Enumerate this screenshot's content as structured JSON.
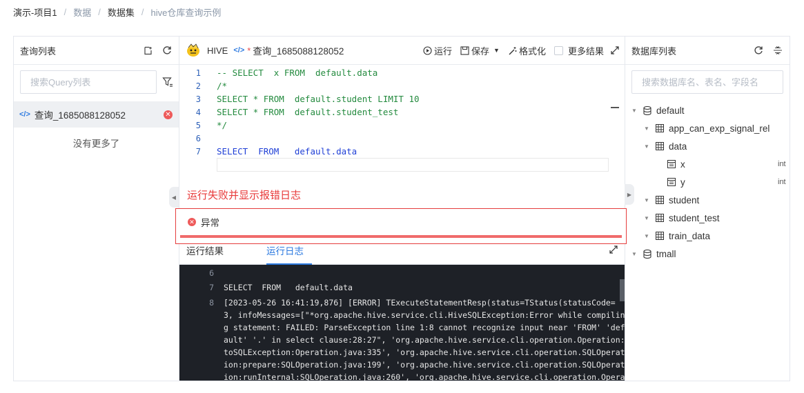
{
  "breadcrumb": {
    "items": [
      "演示-项目1",
      "数据",
      "数据集",
      "hive仓库查询示例"
    ],
    "separator": "/"
  },
  "left_panel": {
    "title": "查询列表",
    "search_placeholder": "搜索Query列表",
    "query_item": "查询_1685088128052",
    "no_more": "没有更多了"
  },
  "editor": {
    "engine_label": "HIVE",
    "code_icon": "</>",
    "unsaved_mark": "*",
    "tab_name": "查询_1685088128052",
    "toolbar": {
      "run": "运行",
      "save": "保存",
      "format": "格式化",
      "more_results": "更多结果"
    },
    "lines": [
      {
        "n": "1",
        "text": "-- SELECT  x FROM  default.data"
      },
      {
        "n": "2",
        "text": "/*"
      },
      {
        "n": "3",
        "text": "SELECT * FROM  default.student LIMIT 10"
      },
      {
        "n": "4",
        "text": "SELECT * FROM  default.student_test"
      },
      {
        "n": "5",
        "text": "*/"
      },
      {
        "n": "6",
        "text": ""
      },
      {
        "n": "7",
        "text": "SELECT  FROM   default.data"
      }
    ]
  },
  "annotation": "运行失败并显示报错日志",
  "error": {
    "label": "异常"
  },
  "result_tabs": [
    "运行结果",
    "运行日志"
  ],
  "log": {
    "lines": [
      {
        "n": "6",
        "text": ""
      },
      {
        "n": "7",
        "text": "SELECT  FROM   default.data"
      },
      {
        "n": "8",
        "text": "[2023-05-26 16:41:19,876] [ERROR] TExecuteStatementResp(status=TStatus(statusCode="
      },
      {
        "n": "",
        "text": "3, infoMessages=[\"*org.apache.hive.service.cli.HiveSQLException:Error while compilin"
      },
      {
        "n": "",
        "text": "g statement: FAILED: ParseException line 1:8 cannot recognize input near 'FROM' 'def"
      },
      {
        "n": "",
        "text": "ault' '.' in select clause:28:27\", 'org.apache.hive.service.cli.operation.Operation:"
      },
      {
        "n": "",
        "text": "toSQLException:Operation.java:335', 'org.apache.hive.service.cli.operation.SQLOperat"
      },
      {
        "n": "",
        "text": "ion:prepare:SQLOperation.java:199', 'org.apache.hive.service.cli.operation.SQLOperat"
      },
      {
        "n": "",
        "text": "ion:runInternal:SQLOperation.java:260', 'org.apache.hive.service.cli.operation.Opera"
      }
    ]
  },
  "right_panel": {
    "title": "数据库列表",
    "search_placeholder": "搜索数据库名、表名、字段名",
    "tree": {
      "db1": "default",
      "t1": "app_can_exp_signal_rel",
      "t2": "data",
      "c1": "x",
      "c1_type": "int",
      "c2": "y",
      "c2_type": "int",
      "t3": "student",
      "t4": "student_test",
      "t5": "train_data",
      "db2": "tmall"
    }
  },
  "colors": {
    "accent": "#2d7ae0",
    "error": "#e53c3c",
    "log_bg": "#1e2127"
  }
}
